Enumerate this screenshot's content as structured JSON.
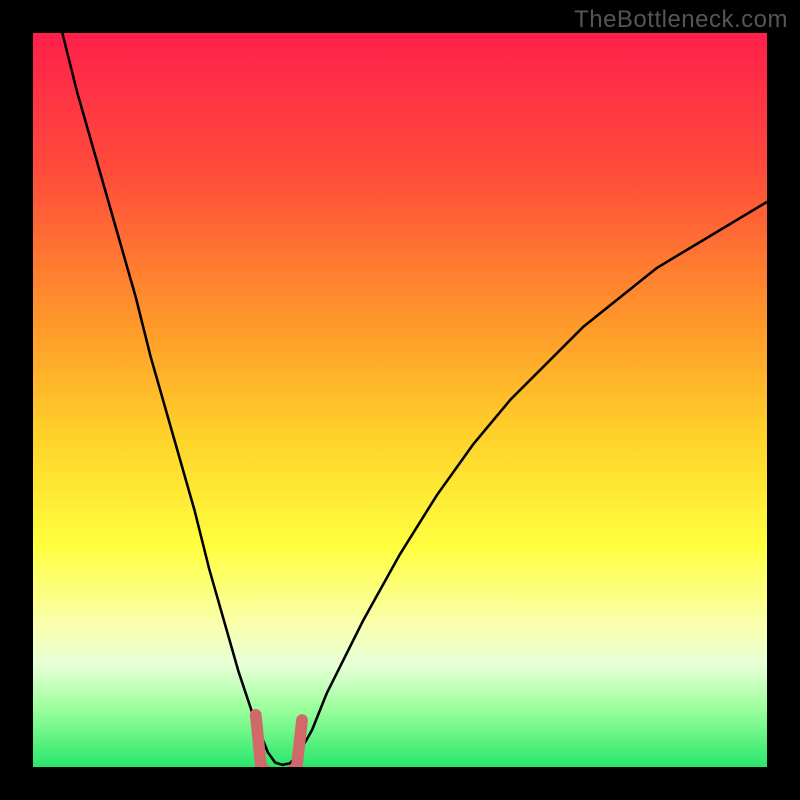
{
  "watermark": "TheBottleneck.com",
  "chart_data": {
    "type": "line",
    "title": "",
    "xlabel": "",
    "ylabel": "",
    "xlim": [
      0,
      100
    ],
    "ylim": [
      0,
      100
    ],
    "background_gradient": {
      "stops": [
        {
          "offset": 0,
          "color": "#ff1f4b"
        },
        {
          "offset": 20,
          "color": "#ff4f3a"
        },
        {
          "offset": 40,
          "color": "#ff9a2a"
        },
        {
          "offset": 55,
          "color": "#ffd22a"
        },
        {
          "offset": 70,
          "color": "#ffff3f"
        },
        {
          "offset": 80,
          "color": "#faffa8"
        },
        {
          "offset": 86,
          "color": "#e8ffd8"
        },
        {
          "offset": 92,
          "color": "#9cff9c"
        },
        {
          "offset": 100,
          "color": "#28e66a"
        }
      ]
    },
    "series": [
      {
        "name": "bottleneck-curve",
        "color": "#000000",
        "x": [
          4,
          6,
          8,
          10,
          12,
          14,
          16,
          18,
          20,
          22,
          24,
          26,
          28,
          30,
          32,
          33,
          34,
          35,
          36,
          38,
          40,
          45,
          50,
          55,
          60,
          65,
          70,
          75,
          80,
          85,
          90,
          95,
          100
        ],
        "y": [
          100,
          92,
          85,
          78,
          71,
          64,
          56,
          49,
          42,
          35,
          27,
          20,
          13,
          7,
          2,
          0.6,
          0.3,
          0.5,
          1.5,
          5,
          10,
          20,
          29,
          37,
          44,
          50,
          55,
          60,
          64,
          68,
          71,
          74,
          77
        ]
      }
    ],
    "annotations": [
      {
        "name": "min-marker",
        "shape": "u-blob",
        "color": "#d06a6a",
        "cx": 33.5,
        "cy": 1.5,
        "rx": 3.5,
        "ry": 3.5
      }
    ]
  }
}
